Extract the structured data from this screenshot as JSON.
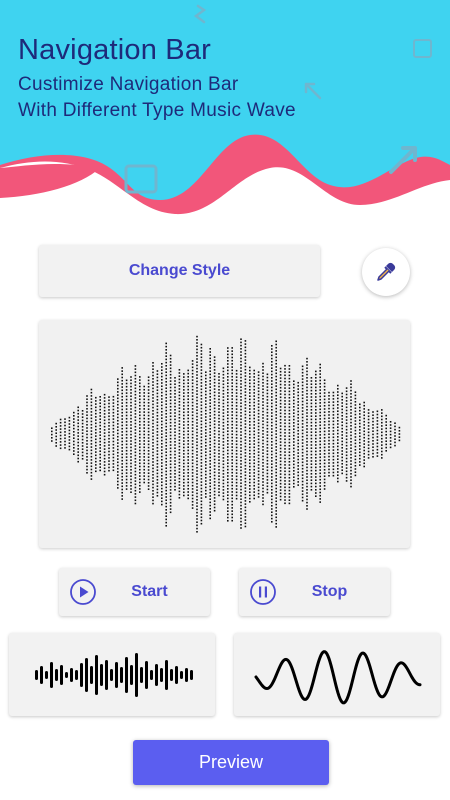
{
  "header": {
    "title": "Navigation Bar",
    "subtitle_line1": "Custimize Navigation Bar",
    "subtitle_line2": "With Different Type Music Wave"
  },
  "controls": {
    "change_style_label": "Change Style",
    "start_label": "Start",
    "stop_label": "Stop",
    "preview_label": "Preview"
  },
  "icons": {
    "color_picker": "eyedropper-icon",
    "start": "play-circle-icon",
    "stop": "pause-circle-icon"
  },
  "colors": {
    "header_cyan": "#3fd3f0",
    "header_pink": "#f2567a",
    "accent_text": "#4a4ad0",
    "preview_button": "#5b5ef0",
    "title_text": "#1e2a7a"
  }
}
